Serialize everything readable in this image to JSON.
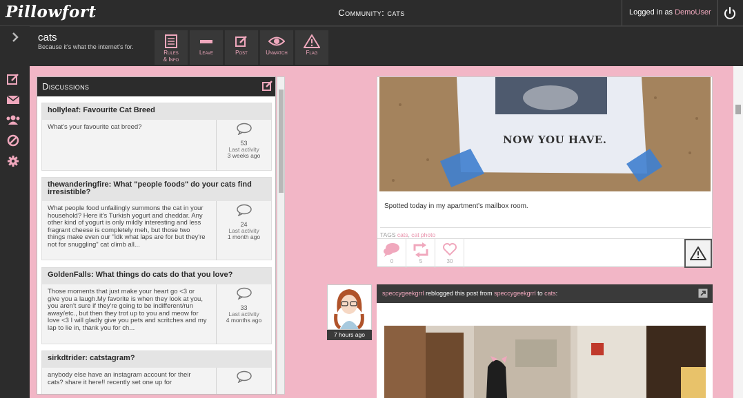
{
  "app": {
    "logo": "Pillowfort",
    "page_title": "Community: cats"
  },
  "topbar": {
    "login_prefix": "Logged in as ",
    "username": "DemoUser",
    "power_icon": "power-icon"
  },
  "sidebar": {
    "icons": [
      "chevron-right-icon",
      "compose-icon",
      "mail-icon",
      "users-icon",
      "block-icon",
      "gear-icon"
    ]
  },
  "community": {
    "name": "cats",
    "tagline": "Because it's what the internet's for.",
    "actions": [
      {
        "label": "Rules\n& Info",
        "icon": "rules-icon"
      },
      {
        "label": "Leave",
        "icon": "minus-icon"
      },
      {
        "label": "Post",
        "icon": "compose-icon"
      },
      {
        "label": "Unwatch",
        "icon": "eye-icon"
      },
      {
        "label": "Flag",
        "icon": "warning-icon"
      }
    ]
  },
  "discussions": {
    "title": "Discussions",
    "last_activity_label": "Last activity",
    "items": [
      {
        "title": "hollyleaf: Favourite Cat Breed",
        "excerpt": "What's your favourite cat breed?",
        "count": "53",
        "ago": "3 weeks ago"
      },
      {
        "title": "thewanderingfire: What \"people foods\" do your cats find irresistible?",
        "excerpt": "What people food unfailingly summons the cat in your household? Here it's Turkish yogurt and cheddar. Any other kind of yogurt is only mildly interesting and less fragrant cheese is completely meh, but those two things make even our \"idk what laps are for but they're not for snuggling\" cat climb all...",
        "count": "24",
        "ago": "1 month ago"
      },
      {
        "title": "GoldenFalls: What things do cats do that you love?",
        "excerpt": "Those moments that just make your heart go <3 or give you a laugh.My favorite is when they look at you, you aren't sure if they're going to be indifferent/run away/etc., but then they trot up to you and meow for love <3 I will gladly give you pets and scritches and my lap to lie in, thank you for ch...",
        "count": "33",
        "ago": "4 months ago"
      },
      {
        "title": "sirkdtrider: catstagram?",
        "excerpt": "anybody else have an instagram account for their cats? share it here!! recently set one up for",
        "count": "",
        "ago": ""
      }
    ]
  },
  "post1": {
    "image_text": "NOW YOU HAVE.",
    "body": "Spotted today in my apartment's mailbox room.",
    "tags_label": "TAGS",
    "tags": [
      "cats",
      "cat photo"
    ],
    "comments": "0",
    "reblogs": "5",
    "likes": "30"
  },
  "post2": {
    "time": "7 hours ago",
    "user": "speccygeekgrrl",
    "reblog_text": " reblogged this post from ",
    "source": "speccygeekgrrl",
    "to_text": " to ",
    "community": "cats",
    "suffix": ":"
  },
  "colors": {
    "pink": "#f2b6c6",
    "dark": "#2c2c2c",
    "accent": "#f0a8bd"
  }
}
